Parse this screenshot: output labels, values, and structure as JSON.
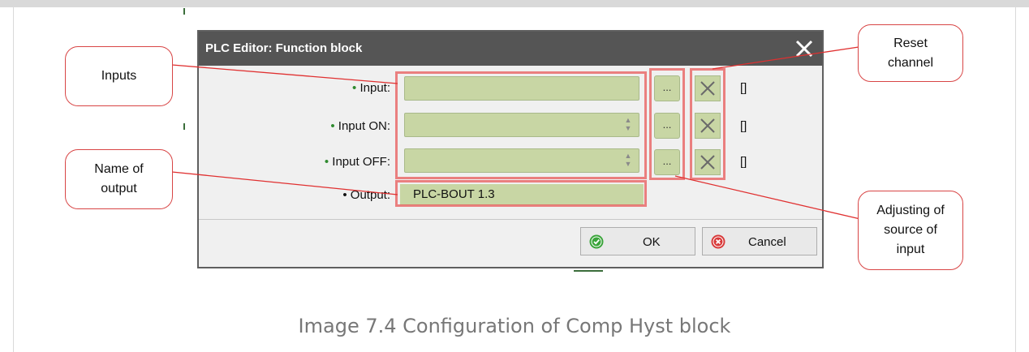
{
  "dialog": {
    "title": "PLC Editor: Function block",
    "fields": [
      {
        "label": "Input:",
        "value": "",
        "channel": "[]"
      },
      {
        "label": "Input ON:",
        "value": "",
        "channel": "[]"
      },
      {
        "label": "Input OFF:",
        "value": "",
        "channel": "[]"
      }
    ],
    "output": {
      "label": "Output:",
      "value": "PLC-BOUT 1.3"
    },
    "browse_label": "...",
    "ok_label": "OK",
    "cancel_label": "Cancel"
  },
  "callouts": {
    "inputs": "Inputs",
    "name_of_output": "Name of\noutput",
    "reset_channel": "Reset\nchannel",
    "adjusting_source": "Adjusting of\nsource of\ninput"
  },
  "caption": "Image 7.4 Configuration of Comp Hyst block",
  "colors": {
    "field_fill": "#c8d6a4",
    "highlight": "#e85a5a",
    "titlebar": "#555555",
    "dot_green": "#2f8a2f"
  }
}
